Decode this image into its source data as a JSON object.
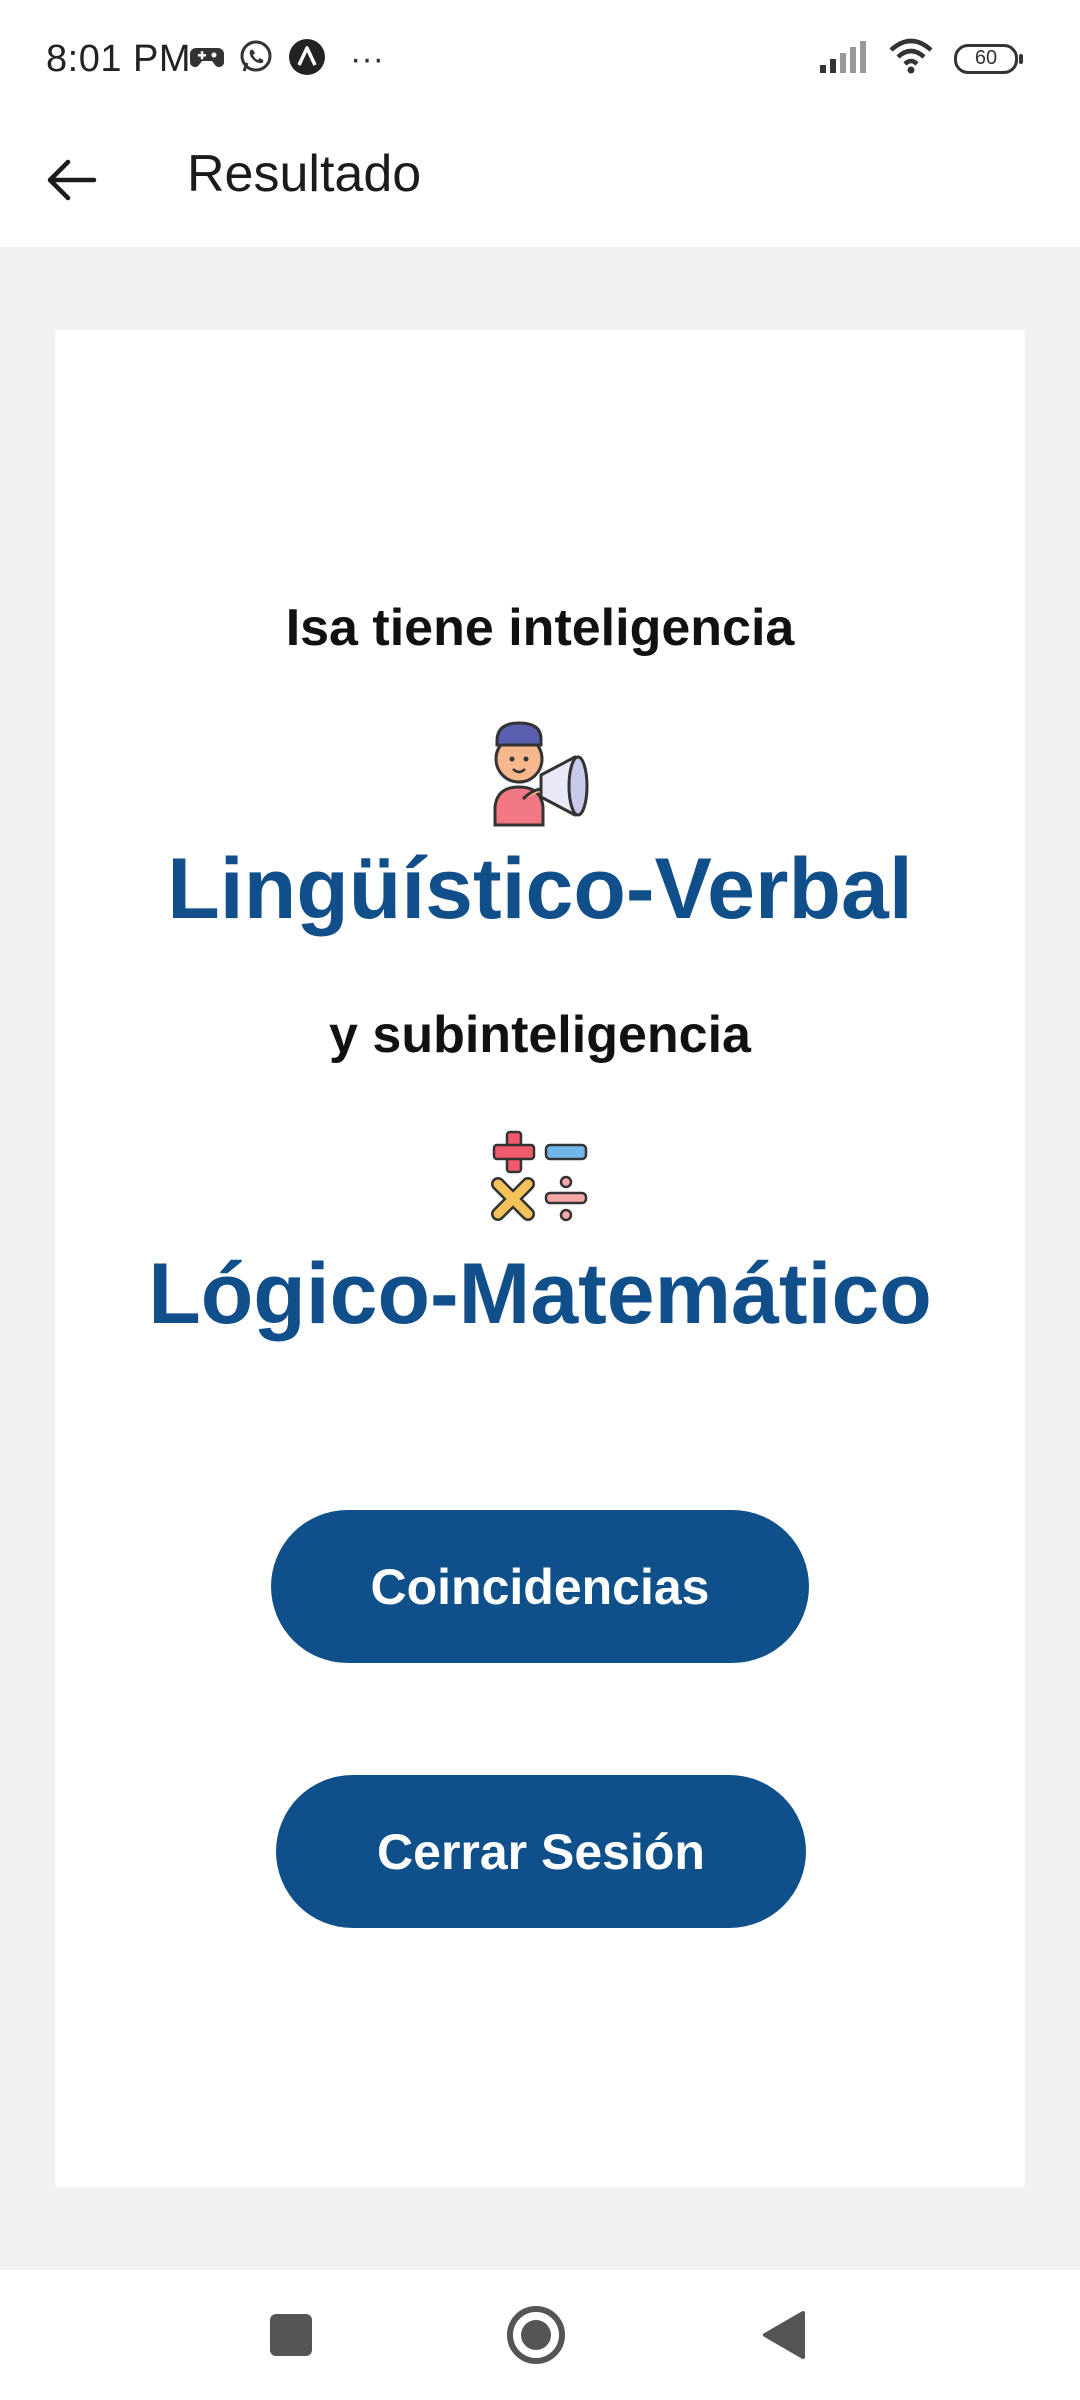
{
  "status_bar": {
    "time": "8:01 PM",
    "more": "···",
    "battery": "60",
    "icons": [
      "game-controller-icon",
      "whatsapp-icon",
      "app-a-icon",
      "signal-icon",
      "wifi-icon",
      "battery-icon"
    ]
  },
  "app_bar": {
    "title": "Resultado",
    "back_icon": "arrow-left-icon"
  },
  "result": {
    "intro": "Isa tiene inteligencia",
    "primary_icon": "person-megaphone-icon",
    "primary": "Lingüístico-Verbal",
    "connector": "y subinteligencia",
    "secondary_icon": "math-operators-icon",
    "secondary": "Lógico-Matemático"
  },
  "actions": {
    "matches_label": "Coincidencias",
    "logout_label": "Cerrar Sesión"
  },
  "nav": {
    "items": [
      "recents-square-icon",
      "home-circle-icon",
      "back-triangle-icon"
    ]
  },
  "colors": {
    "accent": "#114f8b",
    "button": "#0f508b",
    "background": "#f1f1f1",
    "card": "#ffffff"
  }
}
